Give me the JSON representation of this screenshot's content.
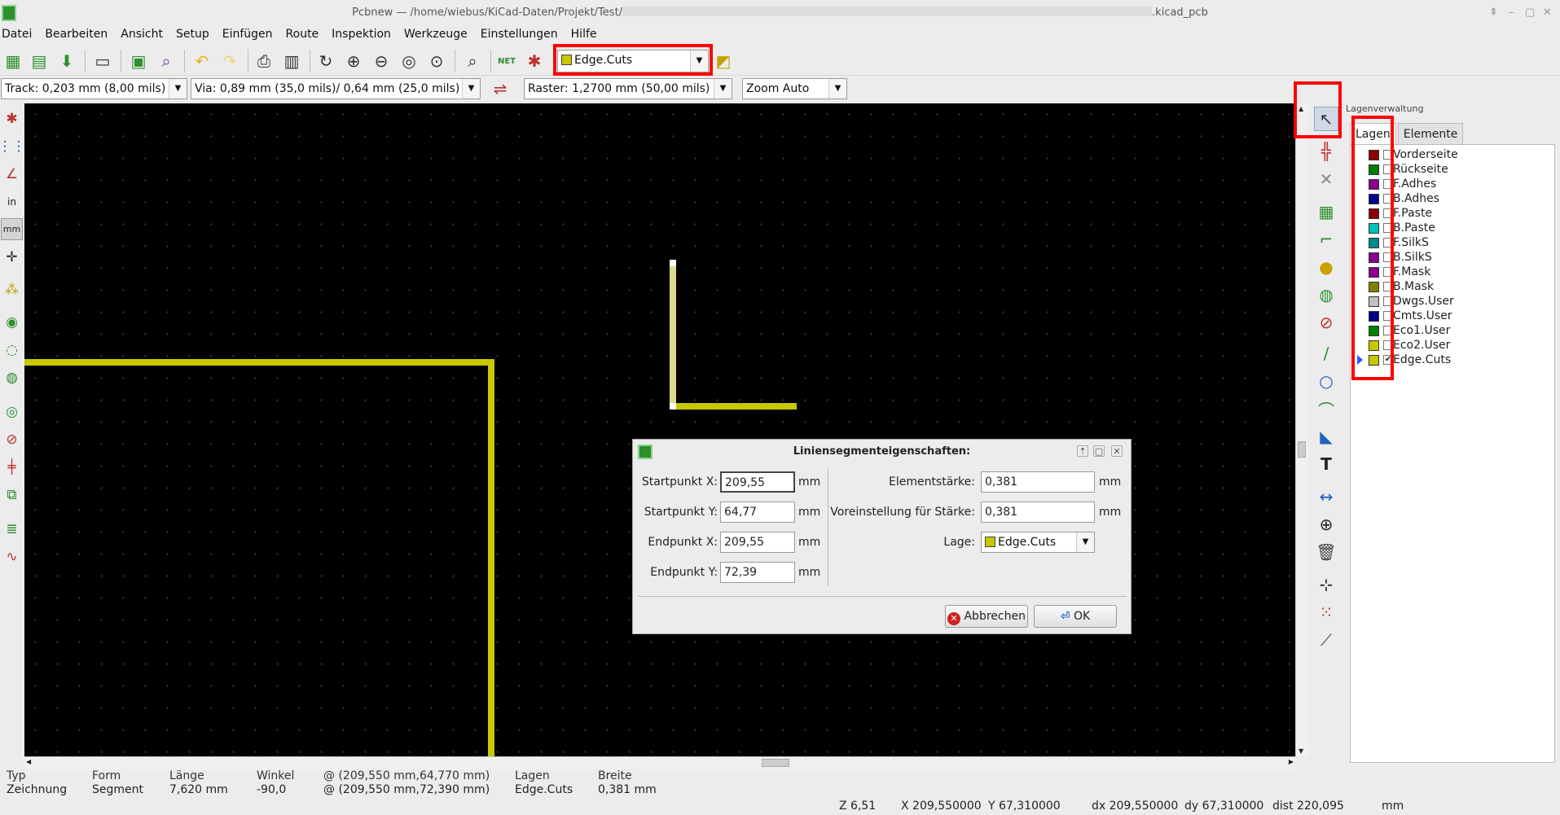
{
  "window": {
    "title": "Pcbnew — /home/wiebus/KiCad-Daten/Projekt/Test/",
    "title_suffix": ".kicad_pcb",
    "controls": [
      "⇞",
      "–",
      "▢",
      "✕"
    ]
  },
  "menu": [
    "Datei",
    "Bearbeiten",
    "Ansicht",
    "Setup",
    "Einfügen",
    "Route",
    "Inspektion",
    "Werkzeuge",
    "Einstellungen",
    "Hilfe"
  ],
  "toolbar": {
    "active_layer": "Edge.Cuts",
    "active_layer_color": "#c8c800",
    "net_label": "NET"
  },
  "toolbar2": {
    "track": "Track: 0,203 mm (8,00 mils) *",
    "via": "Via: 0,89 mm (35,0 mils)/ 0,64 mm (25,0 mils) *",
    "grid": "Raster: 1,2700 mm (50,00 mils)",
    "zoom": "Zoom Auto"
  },
  "left_toolbar": {
    "inch_label": "in",
    "mm_label": "mm"
  },
  "layers_panel": {
    "title": "Lagenverwaltung",
    "tabs": [
      "Lagen",
      "Elemente"
    ],
    "layers": [
      {
        "name": "Vorderseite",
        "color": "#8b0000",
        "checked": false
      },
      {
        "name": "Rückseite",
        "color": "#008000",
        "checked": false
      },
      {
        "name": "F.Adhes",
        "color": "#8b008b",
        "checked": false
      },
      {
        "name": "B.Adhes",
        "color": "#00008b",
        "checked": false
      },
      {
        "name": "F.Paste",
        "color": "#8b0000",
        "checked": false
      },
      {
        "name": "B.Paste",
        "color": "#00c0c0",
        "checked": false
      },
      {
        "name": "F.SilkS",
        "color": "#008b8b",
        "checked": false
      },
      {
        "name": "B.SilkS",
        "color": "#8b008b",
        "checked": false
      },
      {
        "name": "F.Mask",
        "color": "#8b008b",
        "checked": false
      },
      {
        "name": "B.Mask",
        "color": "#808000",
        "checked": false
      },
      {
        "name": "Dwgs.User",
        "color": "#c0c0c0",
        "checked": false
      },
      {
        "name": "Cmts.User",
        "color": "#00008b",
        "checked": false
      },
      {
        "name": "Eco1.User",
        "color": "#008000",
        "checked": false
      },
      {
        "name": "Eco2.User",
        "color": "#c8c800",
        "checked": false
      },
      {
        "name": "Edge.Cuts",
        "color": "#c8c800",
        "checked": true,
        "active": true
      }
    ]
  },
  "dialog": {
    "title": "Liniensegmenteigenschaften:",
    "controls": [
      "⇡",
      "▢",
      "✕"
    ],
    "start_x_label": "Startpunkt X:",
    "start_x": "209,55",
    "start_y_label": "Startpunkt Y:",
    "start_y": "64,77",
    "end_x_label": "Endpunkt X:",
    "end_x": "209,55",
    "end_y_label": "Endpunkt Y:",
    "end_y": "72,39",
    "unit": "mm",
    "width_label": "Elementstärke:",
    "width": "0,381",
    "default_width_label": "Voreinstellung für Stärke:",
    "default_width": "0,381",
    "layer_label": "Lage:",
    "layer": "Edge.Cuts",
    "cancel": "Abbrechen",
    "ok": "OK"
  },
  "status": {
    "columns": [
      {
        "h": "Typ",
        "v": "Zeichnung"
      },
      {
        "h": "Form",
        "v": "Segment"
      },
      {
        "h": "Länge",
        "v": "7,620 mm"
      },
      {
        "h": "Winkel",
        "v": "-90,0"
      },
      {
        "h": "@ (209,550 mm,64,770 mm)",
        "v": "@ (209,550 mm,72,390 mm)"
      },
      {
        "h": "Lagen",
        "v": "Edge.Cuts"
      },
      {
        "h": "Breite",
        "v": "0,381 mm"
      }
    ],
    "zoom": "Z 6,51",
    "x": "X 209,550000",
    "y": "Y 67,310000",
    "dx": "dx 209,550000",
    "dy": "dy 67,310000",
    "dist": "dist 220,095",
    "units": "mm"
  },
  "colors": {
    "edge_cuts": "#c8c800",
    "highlight": "#ff0000",
    "canvas": "#000000"
  }
}
